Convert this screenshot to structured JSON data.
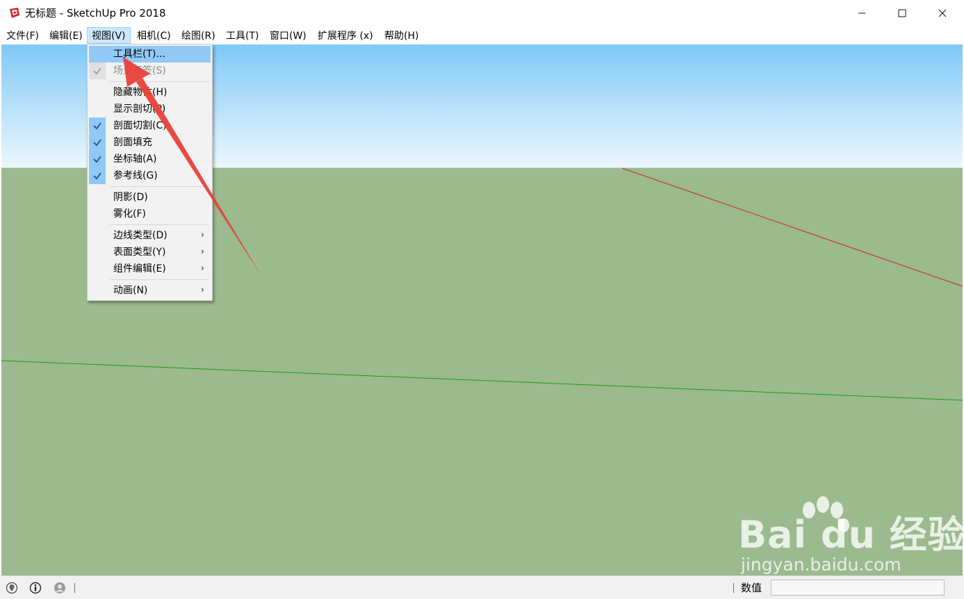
{
  "window": {
    "title": "无标题 - SketchUp Pro 2018",
    "minimize_glyph": "—",
    "maximize_glyph": "☐",
    "close_glyph": "✕"
  },
  "menubar": {
    "items": [
      {
        "label": "文件(F)"
      },
      {
        "label": "编辑(E)"
      },
      {
        "label": "视图(V)",
        "active": true
      },
      {
        "label": "相机(C)"
      },
      {
        "label": "绘图(R)"
      },
      {
        "label": "工具(T)"
      },
      {
        "label": "窗口(W)"
      },
      {
        "label": "扩展程序 (x)"
      },
      {
        "label": "帮助(H)"
      }
    ]
  },
  "view_menu": {
    "items": [
      {
        "label": "工具栏(T)...",
        "checked": false,
        "submenu": false,
        "highlighted": true
      },
      {
        "label": "场景标签(S)",
        "checked": true,
        "disabled": true,
        "submenu": false
      },
      {
        "label": "隐藏物体(H)",
        "checked": false,
        "submenu": false
      },
      {
        "label": "显示剖切(P)",
        "checked": false,
        "submenu": false
      },
      {
        "label": "剖面切割(C)",
        "checked": true,
        "submenu": false
      },
      {
        "label": "剖面填充",
        "checked": true,
        "submenu": false
      },
      {
        "label": "坐标轴(A)",
        "checked": true,
        "submenu": false
      },
      {
        "label": "参考线(G)",
        "checked": true,
        "submenu": false
      },
      {
        "label": "阴影(D)",
        "checked": false,
        "submenu": false
      },
      {
        "label": "雾化(F)",
        "checked": false,
        "submenu": false
      },
      {
        "label": "边线类型(D)",
        "checked": false,
        "submenu": true
      },
      {
        "label": "表面类型(Y)",
        "checked": false,
        "submenu": true
      },
      {
        "label": "组件编辑(E)",
        "checked": false,
        "submenu": true
      },
      {
        "label": "动画(N)",
        "checked": false,
        "submenu": true
      }
    ],
    "check_glyph": "✓",
    "submenu_glyph": "›"
  },
  "statusbar": {
    "measurements_label": "数值",
    "measurements_value": "",
    "icons": [
      "geo-location-icon",
      "credits-icon",
      "user-account-icon"
    ]
  },
  "watermark": {
    "logo_text": "Bai du 经验",
    "url": "jingyan.baidu.com"
  },
  "colors": {
    "sky_top": "#7dc9f7",
    "sky_horizon": "#ecf7fd",
    "ground": "#9bba8e",
    "red_axis": "#d32020",
    "green_axis": "#10a010",
    "annotation_arrow": "#e8413a",
    "menu_highlight": "#91c9f7",
    "menubar_active": "#cce8ff"
  }
}
